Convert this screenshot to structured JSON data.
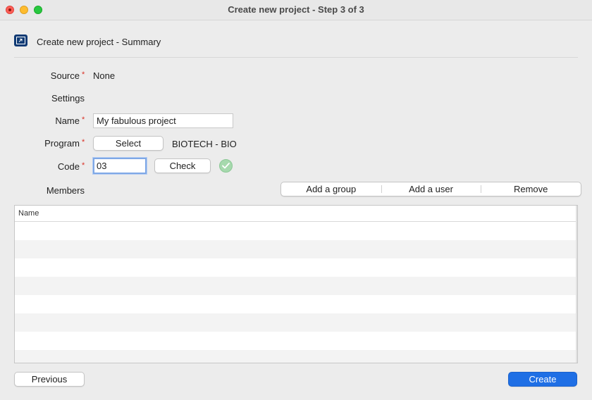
{
  "window": {
    "title": "Create new project - Step 3 of 3"
  },
  "header": {
    "title": "Create new project - Summary",
    "icon": "project-folder-icon"
  },
  "form": {
    "source": {
      "label": "Source",
      "value": "None"
    },
    "settings_label": "Settings",
    "name": {
      "label": "Name",
      "value": "My fabulous project"
    },
    "program": {
      "label": "Program",
      "button": "Select",
      "value": "BIOTECH - BIO"
    },
    "code": {
      "label": "Code",
      "value": "03",
      "button": "Check",
      "status": "valid"
    },
    "required_marker": "*",
    "members_label": "Members"
  },
  "members": {
    "actions": [
      "Add a group",
      "Add a user",
      "Remove"
    ],
    "columns": [
      "Name"
    ],
    "rows": []
  },
  "footer": {
    "previous_label": "Previous",
    "create_label": "Create"
  },
  "colors": {
    "accent": "#1f6fe5",
    "required": "#d93025",
    "valid": "#a6d9ad"
  }
}
